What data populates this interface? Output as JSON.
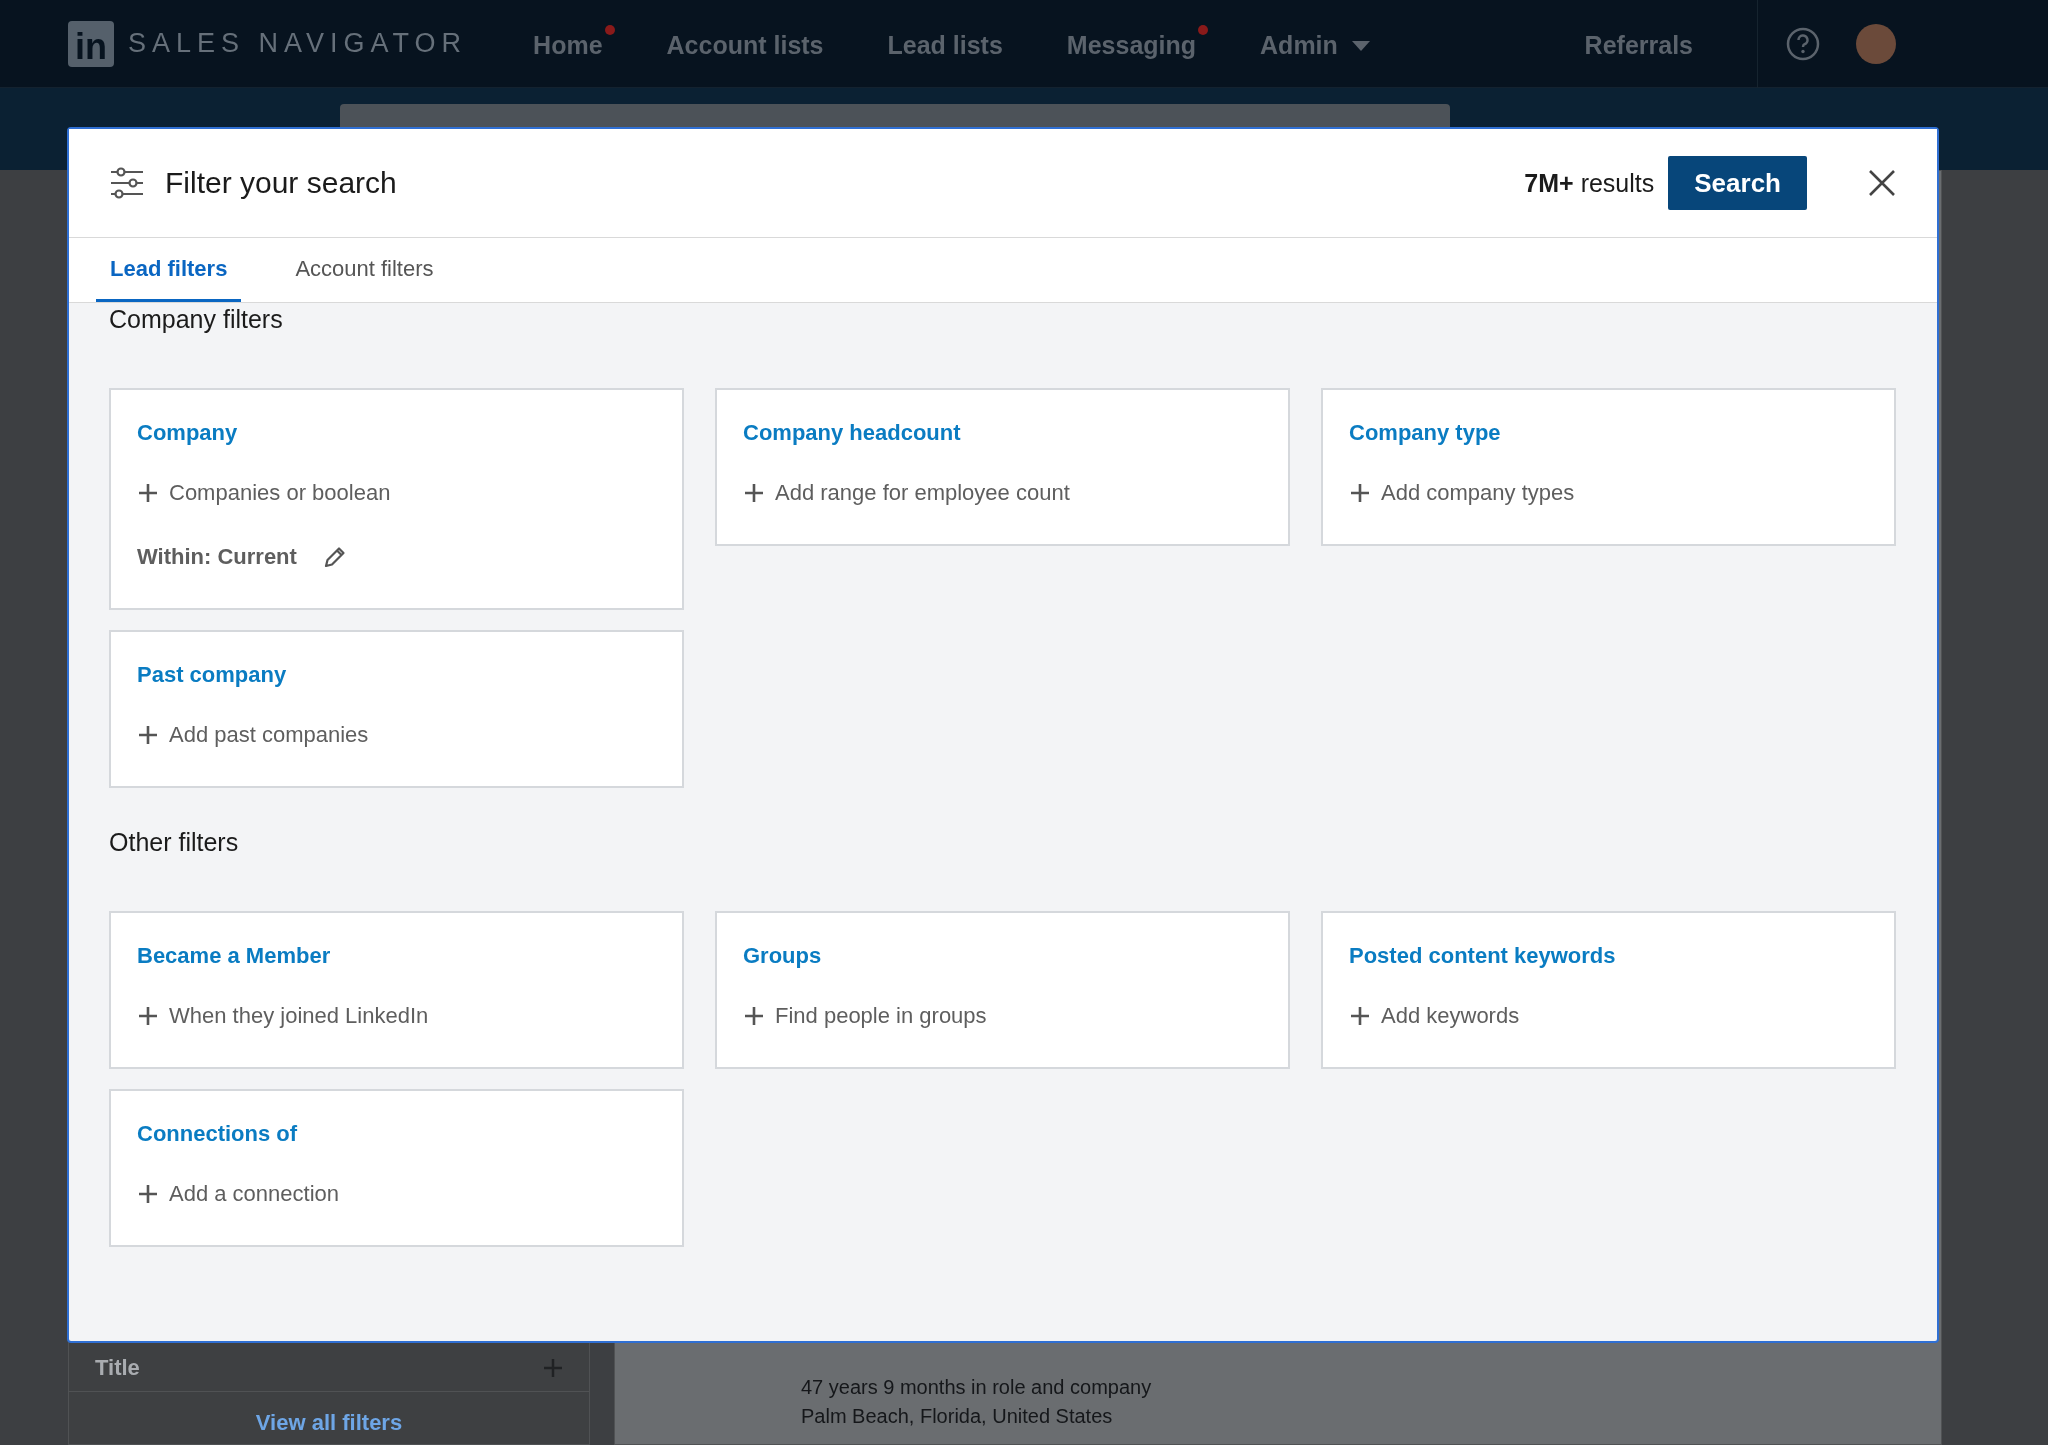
{
  "nav": {
    "logo": "in",
    "brand": "SALES NAVIGATOR",
    "items": [
      {
        "label": "Home",
        "badge": true,
        "dropdown": false
      },
      {
        "label": "Account lists",
        "badge": false,
        "dropdown": false
      },
      {
        "label": "Lead lists",
        "badge": false,
        "dropdown": false
      },
      {
        "label": "Messaging",
        "badge": true,
        "dropdown": false
      },
      {
        "label": "Admin",
        "badge": false,
        "dropdown": true
      }
    ],
    "referrals": "Referrals"
  },
  "background": {
    "sidebar": {
      "filter": "Title",
      "link": "View all filters"
    },
    "result": {
      "lines": [
        "47 years 9 months in role and company",
        "Palm Beach, Florida, United States"
      ]
    }
  },
  "modal": {
    "title": "Filter your search",
    "results_count": "7M+",
    "results_label": "results",
    "search_button": "Search",
    "tabs": [
      {
        "label": "Lead filters",
        "selected": true
      },
      {
        "label": "Account filters",
        "selected": false
      }
    ],
    "sections": [
      {
        "title": "Company filters",
        "filters": [
          {
            "title": "Company",
            "action": "Companies or boolean",
            "within": "Within: Current"
          },
          {
            "title": "Company headcount",
            "action": "Add range for employee count"
          },
          {
            "title": "Company type",
            "action": "Add company types"
          },
          {
            "title": "Past company",
            "action": "Add past companies"
          }
        ]
      },
      {
        "title": "Other filters",
        "filters": [
          {
            "title": "Became a Member",
            "action": "When they joined LinkedIn"
          },
          {
            "title": "Groups",
            "action": "Find people in groups"
          },
          {
            "title": "Posted content keywords",
            "action": "Add keywords"
          },
          {
            "title": "Connections of",
            "action": "Add a connection"
          }
        ]
      }
    ]
  }
}
